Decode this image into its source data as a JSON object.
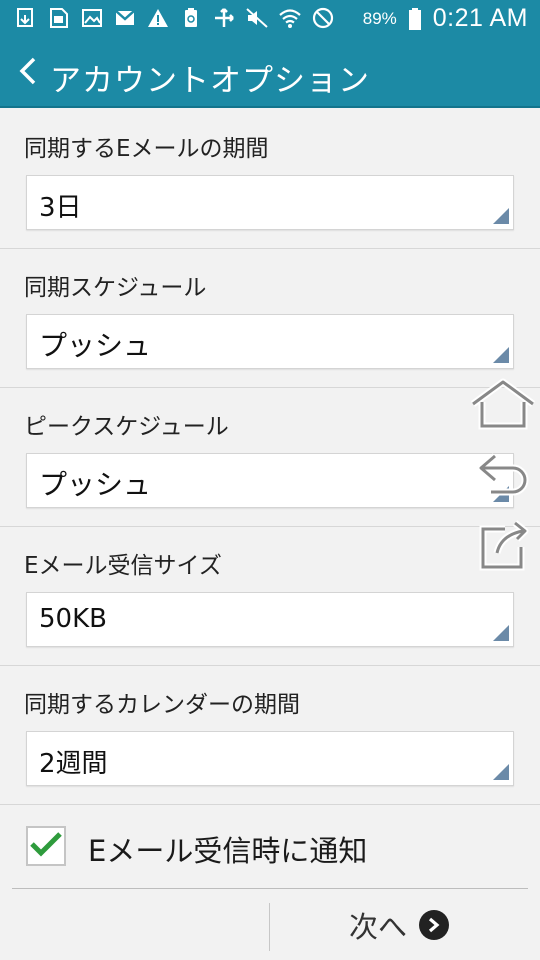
{
  "status_bar": {
    "icons": [
      "download-icon",
      "sim-icon",
      "image-icon",
      "gmail-icon",
      "warning-icon",
      "recycle-icon",
      "sync-arrows-icon",
      "mute-icon",
      "wifi-icon",
      "blocked-icon"
    ],
    "battery": "89%",
    "time": "0:21 AM"
  },
  "header": {
    "title": "アカウントオプション"
  },
  "settings": [
    {
      "label": "同期するEメールの期間",
      "value": "3日"
    },
    {
      "label": "同期スケジュール",
      "value": "プッシュ"
    },
    {
      "label": "ピークスケジュール",
      "value": "プッシュ"
    },
    {
      "label": "Eメール受信サイズ",
      "value": "50KB"
    },
    {
      "label": "同期するカレンダーの期間",
      "value": "2週間"
    }
  ],
  "notify": {
    "label": "Eメール受信時に通知",
    "checked": true
  },
  "footer": {
    "next_label": "次へ"
  },
  "colors": {
    "accent": "#1c8aa5",
    "check": "#2e9b3c"
  }
}
